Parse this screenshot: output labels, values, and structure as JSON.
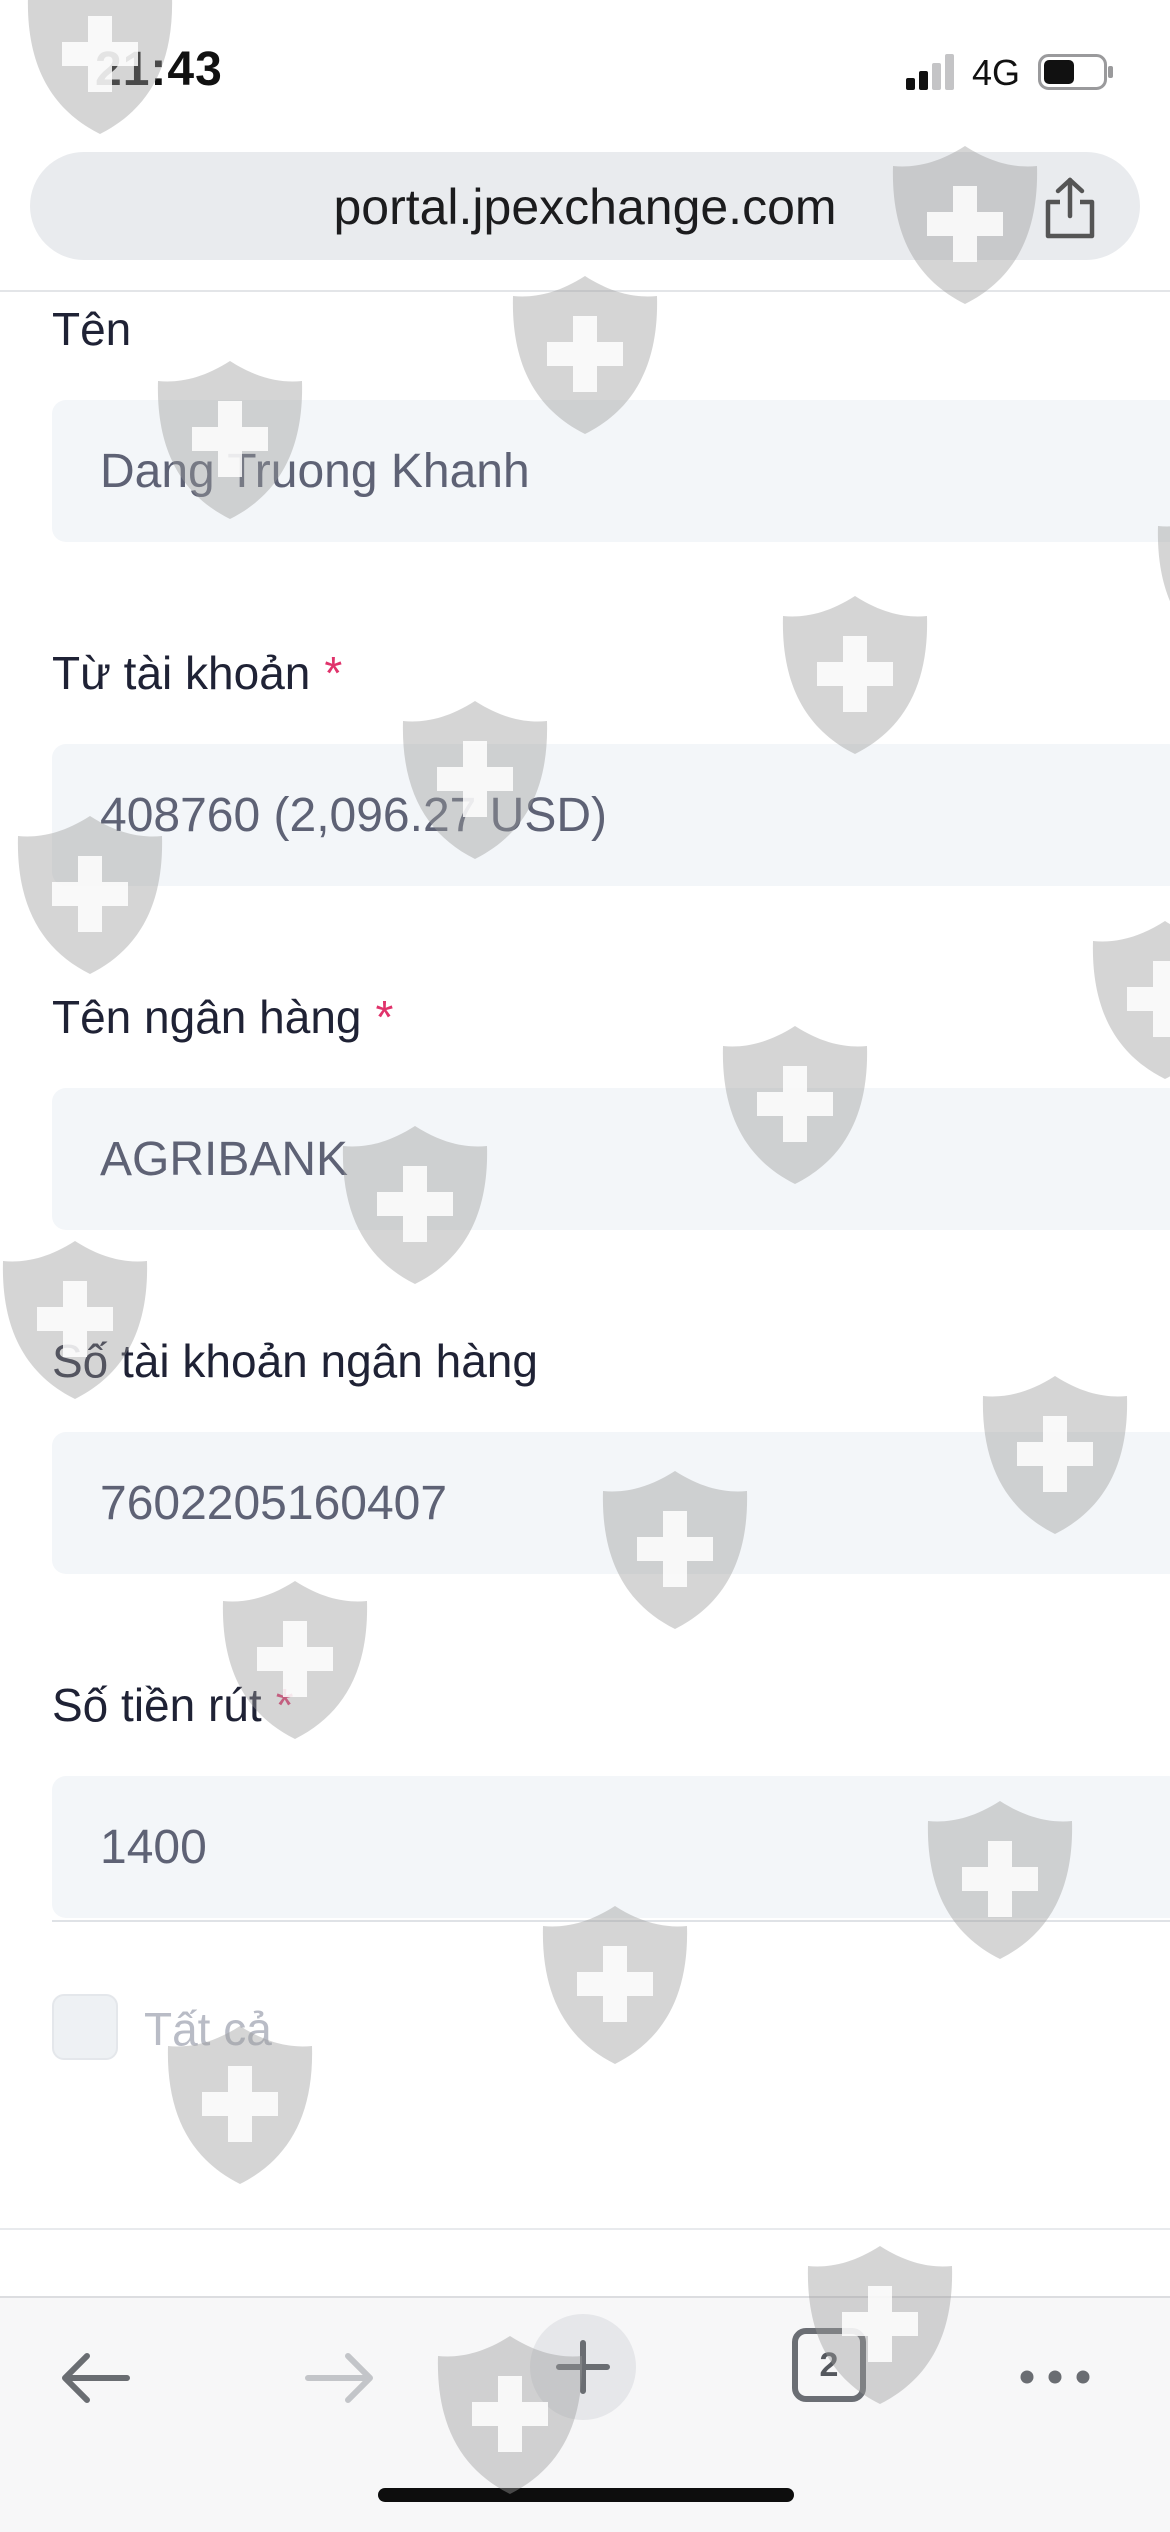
{
  "status_bar": {
    "time": "21:43",
    "network": "4G",
    "signal_bars_active": 2,
    "signal_bars_total": 4,
    "battery_level": 0.5
  },
  "browser": {
    "url": "portal.jpexchange.com",
    "open_tabs": "2",
    "icons": {
      "share": "share-icon",
      "back": "arrow-left-icon",
      "forward": "arrow-right-icon",
      "new_tab": "plus-icon",
      "more": "more-dots-icon"
    }
  },
  "form": {
    "name": {
      "label": "Tên",
      "value": "Dang Truong Khanh"
    },
    "from_account": {
      "label": "Từ tài khoản",
      "required_mark": "*",
      "value": "408760 (2,096.27 USD)"
    },
    "bank_name": {
      "label": "Tên ngân hàng",
      "required_mark": "*",
      "value": "AGRIBANK"
    },
    "bank_account_number": {
      "label": "Số tài khoản ngân hàng",
      "value": "7602205160407"
    },
    "withdraw_amount": {
      "label": "Số tiền rút",
      "required_mark": "*",
      "value": "1400"
    },
    "withdraw_all": {
      "label": "Tất cả",
      "checked": false
    }
  },
  "colors": {
    "required": "#e0336b",
    "field_bg": "#f3f6f9",
    "label_text": "#1f2235",
    "value_text": "#5e6275",
    "watermark": "#9a9a9a"
  },
  "watermark": {
    "icon": "shield-cross-icon"
  }
}
